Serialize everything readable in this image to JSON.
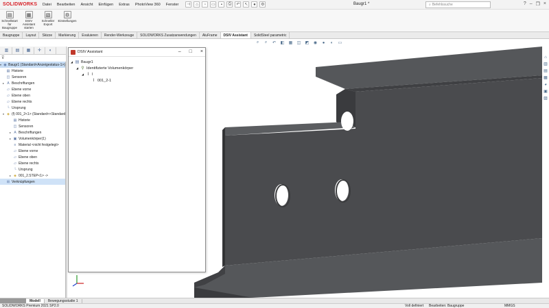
{
  "app": {
    "logo": "SOLIDWORKS",
    "menu": [
      "Datei",
      "Bearbeiten",
      "Ansicht",
      "Einfügen",
      "Extras",
      "PhotoView 360",
      "Fenster"
    ],
    "doc_title": "Baugr1 *",
    "search_placeholder": "Befehlssuche"
  },
  "ribbon": [
    {
      "label": "Schnellstart für Baugruppe"
    },
    {
      "label": "DSIV Assistant starten"
    },
    {
      "label": "Schneller Export"
    },
    {
      "label": "Einstellungen"
    }
  ],
  "tabs": [
    {
      "label": "Baugruppe"
    },
    {
      "label": "Layout"
    },
    {
      "label": "Skizze"
    },
    {
      "label": "Markierung"
    },
    {
      "label": "Evaluieren"
    },
    {
      "label": "Render-Werkzeuge"
    },
    {
      "label": "SOLIDWORKS Zusatzanwendungen"
    },
    {
      "label": "AluFrame"
    },
    {
      "label": "DSIV Assistant"
    },
    {
      "label": "SolidSteel parametric"
    }
  ],
  "tree": [
    {
      "label": "Baugr1  (Standard<Anzeigestatus-1>)",
      "indent": 0
    },
    {
      "label": "Historie",
      "indent": 1
    },
    {
      "label": "Sensoren",
      "indent": 1
    },
    {
      "label": "Beschriftungen",
      "indent": 1
    },
    {
      "label": "Ebene vorne",
      "indent": 1
    },
    {
      "label": "Ebene oben",
      "indent": 1
    },
    {
      "label": "Ebene rechts",
      "indent": 1
    },
    {
      "label": "Ursprung",
      "indent": 1
    },
    {
      "label": "(f) 001_2<1> (Standard<<Standard",
      "indent": 1
    },
    {
      "label": "Historie",
      "indent": 2
    },
    {
      "label": "Sensoren",
      "indent": 2
    },
    {
      "label": "Beschriftungen",
      "indent": 2
    },
    {
      "label": "Volumenkörper(1)",
      "indent": 2
    },
    {
      "label": "Material <nicht festgelegt>",
      "indent": 2
    },
    {
      "label": "Ebene vorne",
      "indent": 2
    },
    {
      "label": "Ebene oben",
      "indent": 2
    },
    {
      "label": "Ebene rechts",
      "indent": 2
    },
    {
      "label": "Ursprung",
      "indent": 2
    },
    {
      "label": "001_2.STEP<1> ->",
      "indent": 2
    },
    {
      "label": "Verknüpfungen",
      "indent": 1
    }
  ],
  "dialog": {
    "title": "DSIV Assistant",
    "rows": [
      {
        "label": "Baugr1"
      },
      {
        "label": "Identifizierte Volumenkörper"
      },
      {
        "label": "I"
      },
      {
        "label": "001_2-1"
      }
    ]
  },
  "bottom_tabs": [
    "Modell",
    "Bewegungsstudie 1"
  ],
  "status": {
    "left": "SOLIDWORKS Premium 2021 SP2.0",
    "defined": "Voll definiert",
    "editing": "Bearbeiten: Baugruppe",
    "units": "MMGS"
  },
  "colors": {
    "accent": "#d71f26",
    "selection": "#c6dcf4",
    "steel": "#4a4b4e"
  }
}
